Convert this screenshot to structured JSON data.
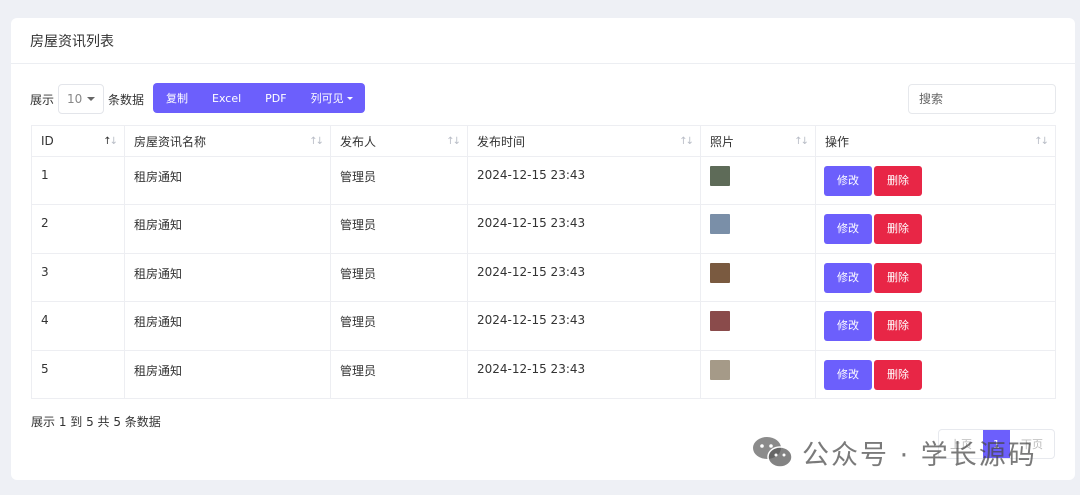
{
  "header": {
    "title": "房屋资讯列表"
  },
  "toolbar": {
    "length_prefix": "展示",
    "length_value": "10",
    "length_suffix": "条数据",
    "buttons": [
      "复制",
      "Excel",
      "PDF",
      "列可见"
    ],
    "search_placeholder": "搜索"
  },
  "table": {
    "columns": [
      "ID",
      "房屋资讯名称",
      "发布人",
      "发布时间",
      "照片",
      "操作"
    ],
    "rows": [
      {
        "id": "1",
        "name": "租房通知",
        "publisher": "管理员",
        "time": "2024-12-15 23:43",
        "photo_color": "#5e6b58"
      },
      {
        "id": "2",
        "name": "租房通知",
        "publisher": "管理员",
        "time": "2024-12-15 23:43",
        "photo_color": "#7a8fa8"
      },
      {
        "id": "3",
        "name": "租房通知",
        "publisher": "管理员",
        "time": "2024-12-15 23:43",
        "photo_color": "#7a5a40"
      },
      {
        "id": "4",
        "name": "租房通知",
        "publisher": "管理员",
        "time": "2024-12-15 23:43",
        "photo_color": "#8a4b4b"
      },
      {
        "id": "5",
        "name": "租房通知",
        "publisher": "管理员",
        "time": "2024-12-15 23:43",
        "photo_color": "#a59a88"
      }
    ],
    "edit_label": "修改",
    "delete_label": "删除"
  },
  "footer": {
    "info": "展示 1 到 5 共 5 条数据",
    "pagination": {
      "prev": "上页",
      "current": "1",
      "next": "下页"
    }
  },
  "watermark": {
    "text": "公众号 · 学长源码",
    "icon": "wechat-icon"
  },
  "colors": {
    "primary": "#6c5ffc",
    "danger": "#e82646",
    "background": "#eef0f5"
  }
}
